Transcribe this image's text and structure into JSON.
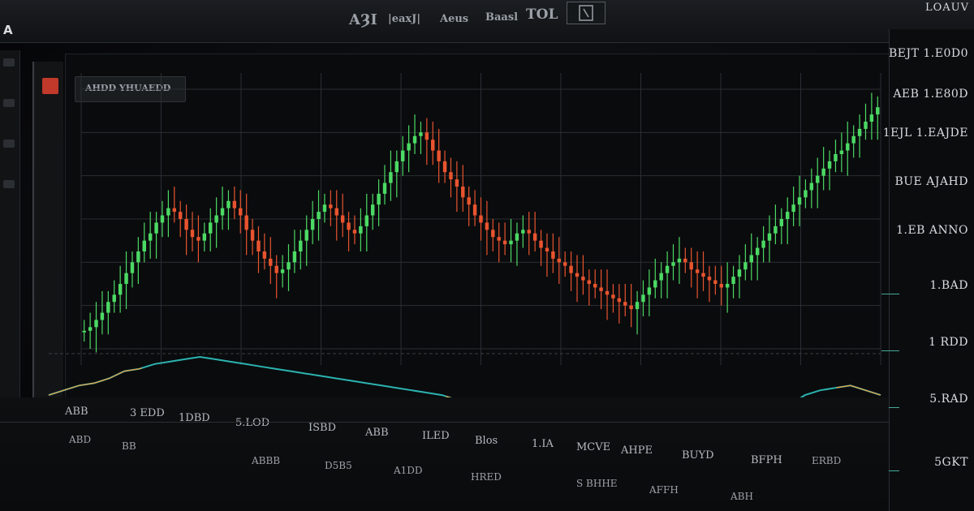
{
  "toolbar": {
    "logo": "A",
    "items": [
      "AȜI",
      "|eaxJ|",
      "Aeus",
      "Baasl",
      "TOL"
    ],
    "window_title": "LOAUV"
  },
  "chart_tab": {
    "label": "AHDD YHUAEDD"
  },
  "price_axis": {
    "labels": [
      "BEJT 1.E0D0",
      "AEB 1.E80D",
      "1EJL 1.EAJDE",
      "BUE AJAHD",
      "1.EB ANNO",
      "1.BAD",
      "1 RDD",
      "5.RAD",
      "5GKT"
    ]
  },
  "time_axis": {
    "labels": [
      "ABB",
      "3 EDD",
      "1DBD",
      "5.LOD",
      "ISBD",
      "ABB",
      "ILED",
      "Blos",
      "1.IA",
      "MCVE",
      "AHPE",
      "BUYD",
      "BFPH"
    ]
  },
  "status_bar": {
    "labels": [
      "ABD",
      "BB",
      "ABBB",
      "D5B5",
      "A1DD",
      "HRED",
      "S BHHE",
      "AFFH",
      "ABH",
      "ERBD"
    ]
  },
  "colors": {
    "bull": "#4cd964",
    "bear": "#e8542f",
    "neutral": "#f0a24a",
    "indicator": "#2bb3b0",
    "indicator_alt": "#f0a040",
    "grid": "#2a2e33"
  },
  "chart_data": {
    "type": "candlestick",
    "series": [
      {
        "name": "",
        "values": [
          30,
          31,
          33,
          35,
          38,
          40,
          43,
          46,
          49,
          52,
          55,
          57,
          60,
          62,
          64,
          63,
          61,
          58,
          56,
          55,
          57,
          60,
          62,
          64,
          66,
          64,
          62,
          58,
          55,
          52,
          50,
          48,
          46,
          47,
          49,
          52,
          55,
          58,
          61,
          63,
          65,
          64,
          62,
          60,
          58,
          57,
          59,
          62,
          65,
          68,
          71,
          74,
          77,
          80,
          82,
          84,
          85,
          83,
          80,
          77,
          74,
          72,
          70,
          67,
          65,
          62,
          60,
          58,
          56,
          55,
          54,
          55,
          57,
          58,
          57,
          55,
          53,
          52,
          50,
          49,
          48,
          46,
          45,
          44,
          43,
          42,
          41,
          40,
          39,
          38,
          37,
          36,
          38,
          40,
          42,
          44,
          46,
          48,
          49,
          50,
          49,
          47,
          46,
          45,
          44,
          43,
          42,
          43,
          45,
          47,
          49,
          51,
          53,
          55,
          57,
          59,
          61,
          63,
          65,
          67,
          69,
          71,
          73,
          75,
          77,
          79,
          80,
          82,
          84,
          86,
          88,
          90,
          92
        ]
      }
    ],
    "indicator": [
      20,
      22,
      24,
      25,
      27,
      30,
      31,
      33,
      34,
      35,
      36,
      35,
      34,
      33,
      32,
      31,
      30,
      29,
      28,
      27,
      26,
      25,
      24,
      23,
      22,
      21,
      20,
      18,
      17,
      16,
      15,
      14,
      13,
      12,
      11,
      10,
      9,
      8,
      7,
      6,
      5,
      4,
      3,
      2,
      2,
      3,
      5,
      8,
      12,
      16,
      20,
      22,
      23,
      24,
      22,
      20
    ],
    "grid": true
  }
}
